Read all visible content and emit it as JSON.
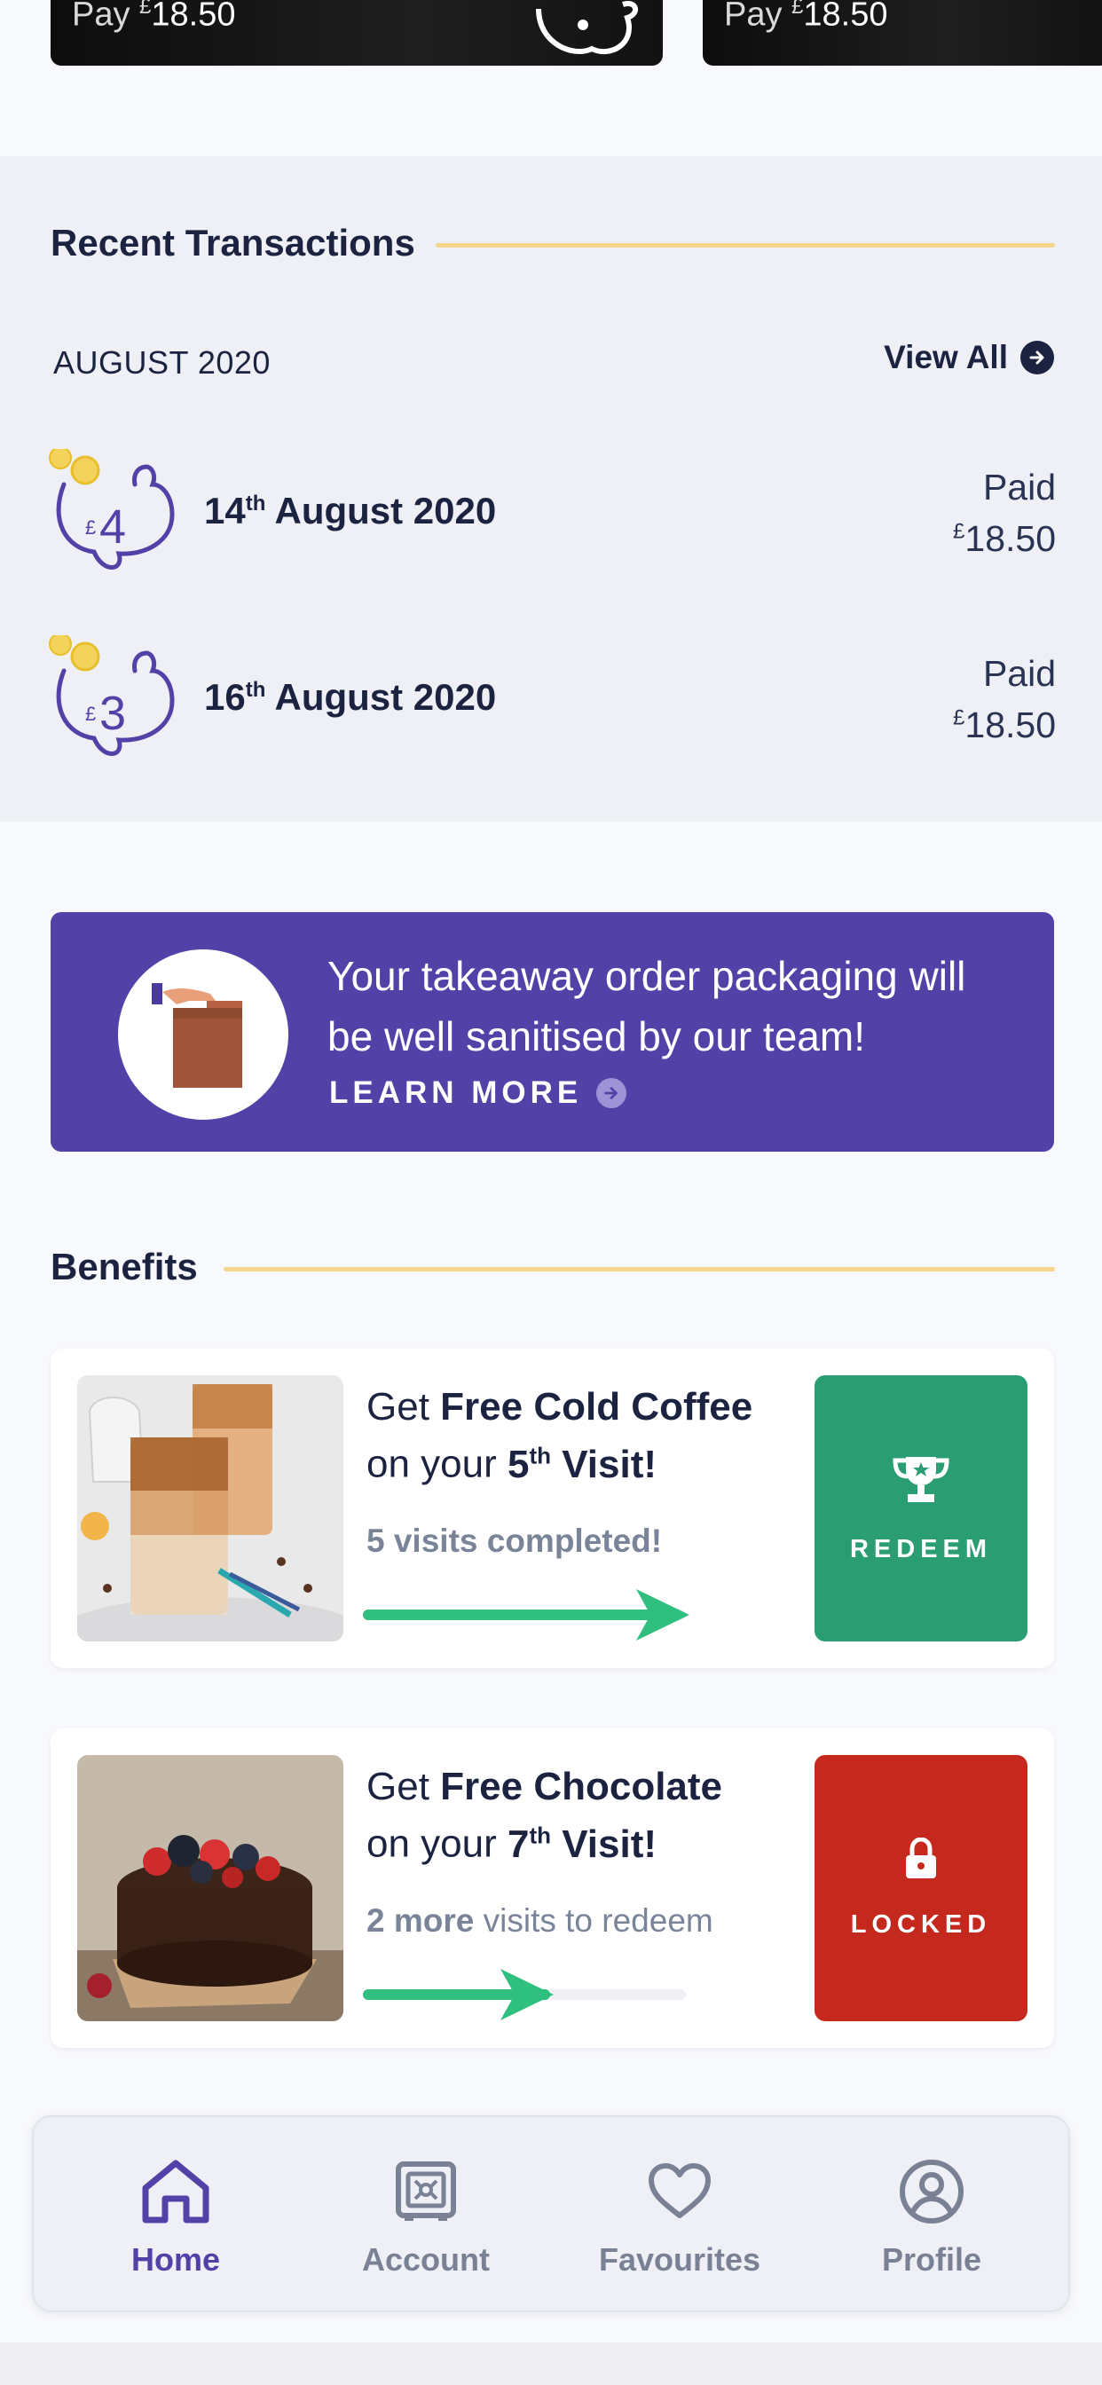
{
  "pay_cards": [
    {
      "prefix": "Pay ",
      "currency": "£",
      "amount": "18.50"
    },
    {
      "prefix": "Pay ",
      "currency": "£",
      "amount": "18.50"
    }
  ],
  "recent": {
    "title": "Recent Transactions",
    "month": "AUGUST 2020",
    "view_all": "View All",
    "transactions": [
      {
        "badge_currency": "£",
        "badge_value": "4",
        "day": "14",
        "day_suffix": "th",
        "date_rest": " August 2020",
        "status": "Paid",
        "currency": "£",
        "amount": "18.50"
      },
      {
        "badge_currency": "£",
        "badge_value": "3",
        "day": "16",
        "day_suffix": "th",
        "date_rest": " August 2020",
        "status": "Paid",
        "currency": "£",
        "amount": "18.50"
      }
    ]
  },
  "promo": {
    "message": "Your takeaway order packaging will be well sanitised by our team!",
    "cta": "LEARN MORE"
  },
  "benefits": {
    "title": "Benefits",
    "items": [
      {
        "pre": "Get ",
        "bold": "Free Cold Coffee",
        "line2_pre": "on your ",
        "visit_num": "5",
        "visit_suffix": "th",
        "visit_word": " Visit!",
        "status_bold": "5 visits completed!",
        "status_rest": "",
        "progress": 1.0,
        "action": "REDEEM",
        "action_color": "#2a9d73",
        "action_icon": "trophy-icon"
      },
      {
        "pre": "Get ",
        "bold": "Free Chocolate",
        "line2_pre": "on your ",
        "visit_num": "7",
        "visit_suffix": "th",
        "visit_word": " Visit!",
        "status_bold": "2 more",
        "status_rest": " visits to redeem",
        "progress": 0.58,
        "action": "LOCKED",
        "action_color": "#c5291e",
        "action_icon": "lock-icon"
      }
    ]
  },
  "nav": {
    "items": [
      {
        "label": "Home",
        "icon": "home-icon",
        "active": true
      },
      {
        "label": "Account",
        "icon": "safe-icon",
        "active": false
      },
      {
        "label": "Favourites",
        "icon": "heart-icon",
        "active": false
      },
      {
        "label": "Profile",
        "icon": "user-circle-icon",
        "active": false
      }
    ]
  },
  "colors": {
    "accent": "#5242a8",
    "navy": "#1b2341",
    "gold_line": "#f6d58c",
    "redeem": "#2a9d73",
    "locked": "#c5291e",
    "progress": "#2fbf7e"
  }
}
